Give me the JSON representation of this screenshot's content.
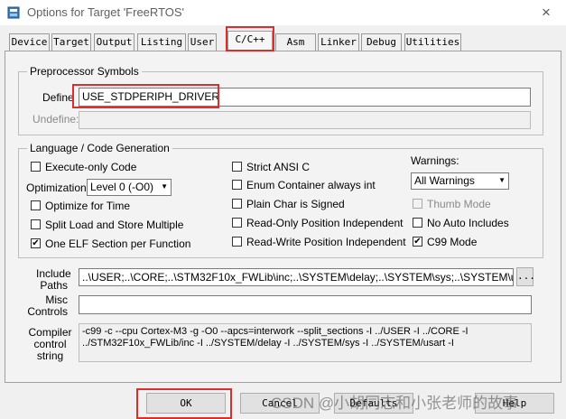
{
  "window": {
    "title": "Options for Target 'FreeRTOS'",
    "close_glyph": "×"
  },
  "tabs": [
    {
      "label": "Device"
    },
    {
      "label": "Target"
    },
    {
      "label": "Output"
    },
    {
      "label": "Listing"
    },
    {
      "label": "User"
    },
    {
      "label": "C/C++"
    },
    {
      "label": "Asm"
    },
    {
      "label": "Linker"
    },
    {
      "label": "Debug"
    },
    {
      "label": "Utilities"
    }
  ],
  "preprocessor": {
    "title": "Preprocessor Symbols",
    "define_label": "Define",
    "define_value": "USE_STDPERIPH_DRIVER",
    "undefine_label": "Undefine:",
    "undefine_value": ""
  },
  "language": {
    "title": "Language / Code Generation",
    "execute_only": {
      "label": "Execute-only Code",
      "checked": false
    },
    "optimization_label": "Optimization:",
    "optimization_value": "Level 0 (-O0)",
    "optimize_time": {
      "label": "Optimize for Time",
      "checked": false
    },
    "split_load": {
      "label": "Split Load and Store Multiple",
      "checked": false
    },
    "one_elf": {
      "label": "One ELF Section per Function",
      "checked": true
    },
    "strict_ansi": {
      "label": "Strict ANSI C",
      "checked": false
    },
    "enum_container": {
      "label": "Enum Container always int",
      "checked": false
    },
    "plain_char": {
      "label": "Plain Char is Signed",
      "checked": false
    },
    "ro_pi": {
      "label": "Read-Only Position Independent",
      "checked": false
    },
    "rw_pi": {
      "label": "Read-Write Position Independent",
      "checked": false
    },
    "warnings_label": "Warnings:",
    "warnings_value": "All Warnings",
    "thumb_mode": {
      "label": "Thumb Mode",
      "checked": false
    },
    "no_auto_includes": {
      "label": "No Auto Includes",
      "checked": false
    },
    "c99_mode": {
      "label": "C99 Mode",
      "checked": true
    }
  },
  "include": {
    "label_line1": "Include",
    "label_line2": "Paths",
    "value": "..\\USER;..\\CORE;..\\STM32F10x_FWLib\\inc;..\\SYSTEM\\delay;..\\SYSTEM\\sys;..\\SYSTEM\\usart;..\\",
    "browse_label": "..."
  },
  "misc": {
    "label_line1": "Misc",
    "label_line2": "Controls",
    "value": ""
  },
  "compiler": {
    "label_line1": "Compiler",
    "label_line2": "control",
    "label_line3": "string",
    "line1": "-c99 -c --cpu Cortex-M3 -g -O0 --apcs=interwork --split_sections -I ../USER -I ../CORE -I",
    "line2": "../STM32F10x_FWLib/inc -I ../SYSTEM/delay -I ../SYSTEM/sys -I ../SYSTEM/usart -I"
  },
  "buttons": {
    "ok": "OK",
    "cancel": "Cancel",
    "defaults": "Defaults",
    "help": "Help"
  },
  "watermark": "CSDN @小胡同志和小张老师的故事",
  "colors": {
    "highlight": "#d9302c"
  }
}
